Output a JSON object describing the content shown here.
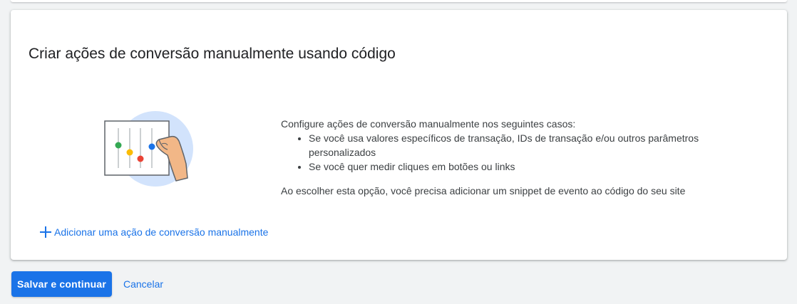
{
  "card": {
    "title": "Criar ações de conversão manualmente usando código",
    "illustration_icon": "sliders-hand-illustration",
    "description": {
      "intro": "Configure ações de conversão manualmente nos seguintes casos:",
      "bullets": [
        "Se você usa valores específicos de transação, IDs de transação e/ou outros parâmetros personalizados",
        "Se você quer medir cliques em botões ou links"
      ],
      "note": "Ao escolher esta opção, você precisa adicionar um snippet de evento ao código do seu site"
    },
    "add_link": {
      "icon": "plus-icon",
      "label": "Adicionar uma ação de conversão manualmente"
    }
  },
  "actions": {
    "save_label": "Salvar e continuar",
    "cancel_label": "Cancelar"
  },
  "colors": {
    "accent": "#1a73e8",
    "page_background": "#f1f3f4",
    "card_background": "#ffffff",
    "text": "#3c4043"
  }
}
